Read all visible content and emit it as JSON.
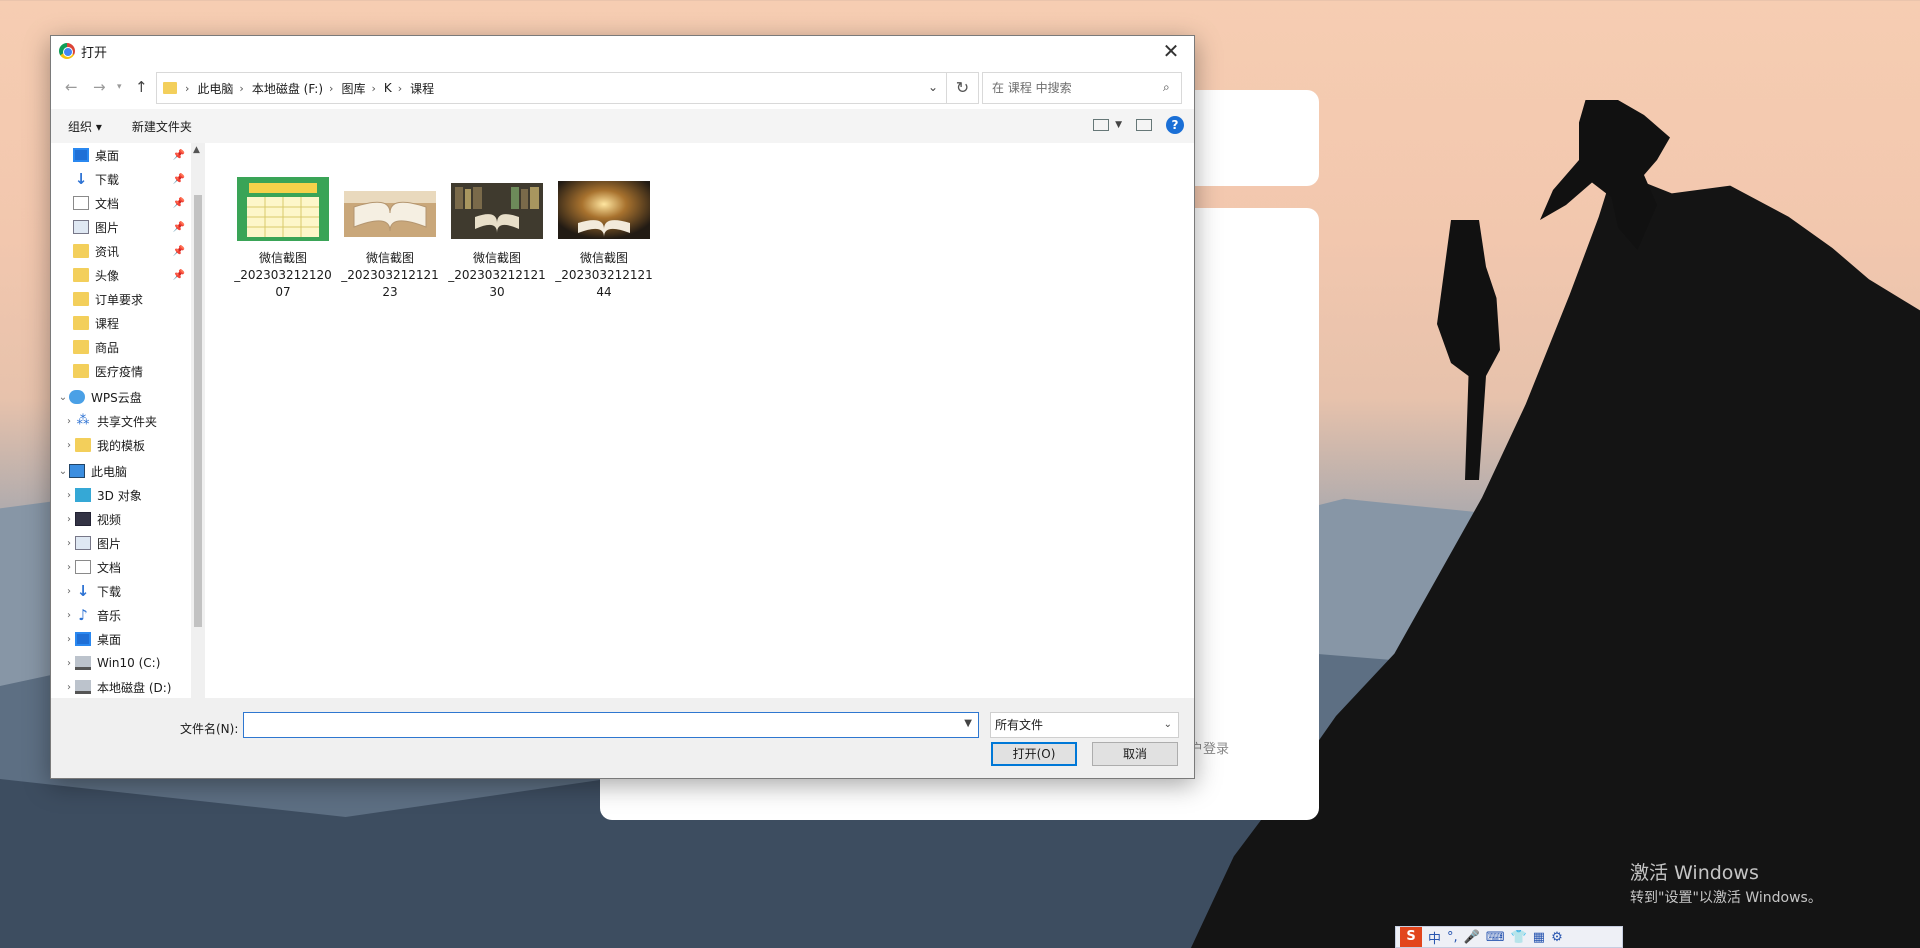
{
  "dialog": {
    "title": "打开",
    "close_label": "✕",
    "address": {
      "crumbs": [
        "此电脑",
        "本地磁盘 (F:)",
        "图库",
        "K",
        "课程"
      ]
    },
    "search": {
      "placeholder": "在 课程 中搜索"
    },
    "toolbar": {
      "organize": "组织 ▾",
      "new_folder": "新建文件夹"
    },
    "nav": {
      "items": [
        {
          "label": "桌面",
          "icon": "desktop-icon",
          "pinned": true
        },
        {
          "label": "下载",
          "icon": "download-icon",
          "pinned": true
        },
        {
          "label": "文档",
          "icon": "document-icon",
          "pinned": true
        },
        {
          "label": "图片",
          "icon": "picture-icon",
          "pinned": true
        },
        {
          "label": "资讯",
          "icon": "folder-icon",
          "pinned": true
        },
        {
          "label": "头像",
          "icon": "folder-icon",
          "pinned": true
        },
        {
          "label": "订单要求",
          "icon": "folder-icon",
          "pinned": false
        },
        {
          "label": "课程",
          "icon": "folder-icon",
          "pinned": false
        },
        {
          "label": "商品",
          "icon": "folder-icon",
          "pinned": false
        },
        {
          "label": "医疗疫情",
          "icon": "folder-icon",
          "pinned": false
        },
        {
          "label": "WPS云盘",
          "icon": "cloud-icon",
          "pinned": false
        },
        {
          "label": "共享文件夹",
          "icon": "share-icon",
          "pinned": false
        },
        {
          "label": "我的模板",
          "icon": "folder-icon",
          "pinned": false
        },
        {
          "label": "此电脑",
          "icon": "computer-icon",
          "pinned": false
        },
        {
          "label": "3D 对象",
          "icon": "3d-objects-icon",
          "pinned": false
        },
        {
          "label": "视频",
          "icon": "video-icon",
          "pinned": false
        },
        {
          "label": "图片",
          "icon": "picture-icon",
          "pinned": false
        },
        {
          "label": "文档",
          "icon": "document-icon",
          "pinned": false
        },
        {
          "label": "下载",
          "icon": "download-icon",
          "pinned": false
        },
        {
          "label": "音乐",
          "icon": "music-icon",
          "pinned": false
        },
        {
          "label": "桌面",
          "icon": "desktop-icon",
          "pinned": false
        },
        {
          "label": "Win10 (C:)",
          "icon": "drive-icon",
          "pinned": false
        },
        {
          "label": "本地磁盘 (D:)",
          "icon": "drive-icon",
          "pinned": false
        }
      ]
    },
    "files": [
      {
        "name_line1": "微信截图",
        "name_line2": "_202303212120",
        "name_line3": "07"
      },
      {
        "name_line1": "微信截图",
        "name_line2": "_202303212121",
        "name_line3": "23"
      },
      {
        "name_line1": "微信截图",
        "name_line2": "_202303212121",
        "name_line3": "30"
      },
      {
        "name_line1": "微信截图",
        "name_line2": "_202303212121",
        "name_line3": "44"
      }
    ],
    "footer": {
      "filename_label": "文件名(N):",
      "filename_value": "",
      "filetype": "所有文件",
      "open_button": "打开(O)",
      "cancel_button": "取消"
    }
  },
  "background": {
    "login_link": "户登录",
    "activate_title": "激活 Windows",
    "activate_sub": "转到\"设置\"以激活 Windows。"
  },
  "ime": {
    "logo": "S",
    "mode": "中"
  }
}
